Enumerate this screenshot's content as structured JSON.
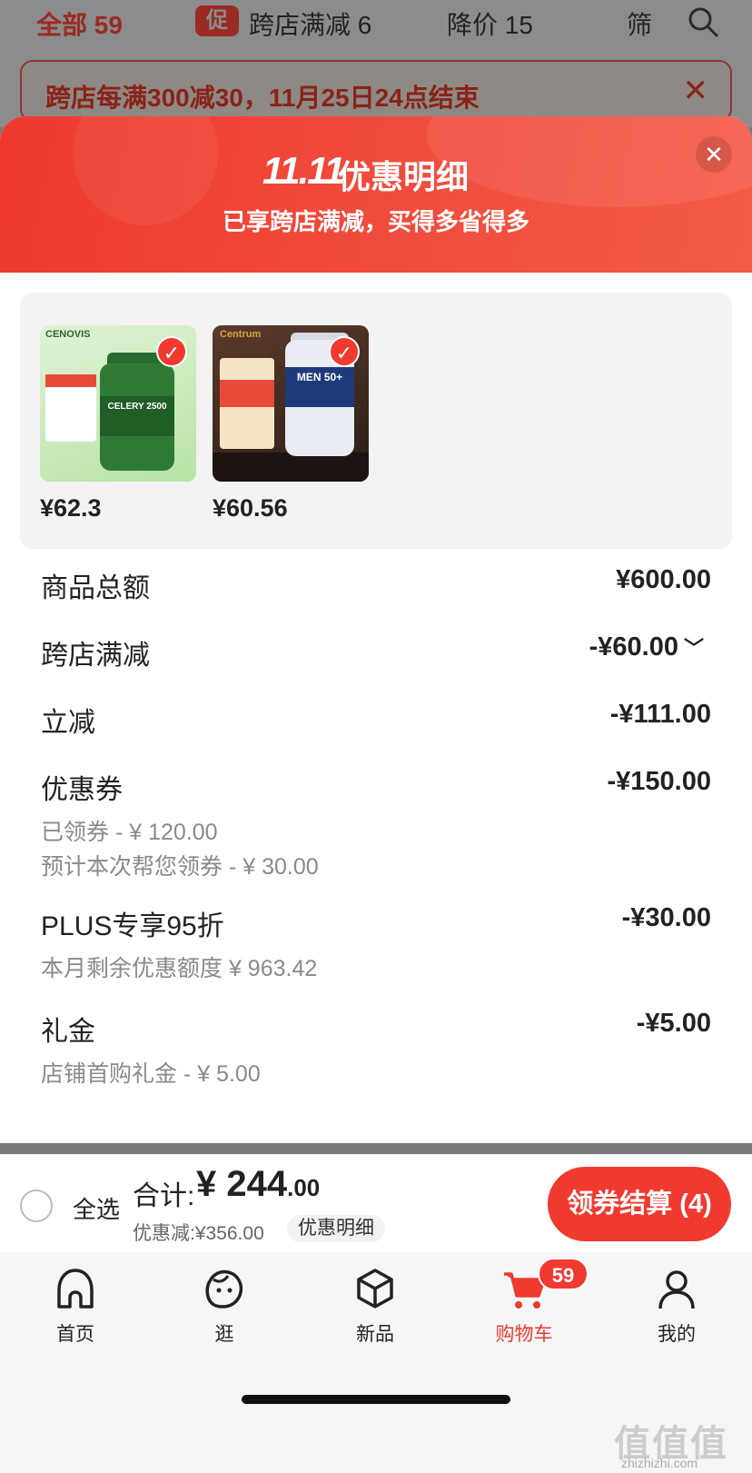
{
  "background": {
    "tabs": [
      {
        "label": "全部 59"
      },
      {
        "label": "跨店满减 6"
      },
      {
        "label": "降价 15"
      },
      {
        "label": "筛"
      }
    ],
    "promo_icon": "促",
    "notice": "跨店每满300减30，11月25日24点结束"
  },
  "sheet": {
    "logo": "11.11",
    "title": "优惠明细",
    "subtitle": "已享跨店满减，买得多省得多",
    "products": [
      {
        "price": "¥62.3",
        "brand": "CENOVIS",
        "label": "CELERY 2500",
        "image": "green-bottle"
      },
      {
        "price": "¥60.56",
        "brand": "Centrum",
        "label": "MEN 50+",
        "image": "white-bottle"
      }
    ],
    "rows": [
      {
        "label": "商品总额",
        "value": "¥600.00"
      },
      {
        "label": "跨店满减",
        "value": "-¥60.00"
      },
      {
        "label": "立减",
        "value": "-¥111.00"
      },
      {
        "label": "优惠券",
        "value": "-¥150.00",
        "subs": [
          "已领券 - ¥ 120.00",
          "预计本次帮您领券 - ¥ 30.00"
        ]
      },
      {
        "label": "PLUS专享95折",
        "value": "-¥30.00",
        "subs": [
          "本月剩余优惠额度 ¥ 963.42"
        ]
      },
      {
        "label": "礼金",
        "value": "-¥5.00",
        "subs": [
          "店铺首购礼金 - ¥ 5.00"
        ]
      }
    ]
  },
  "summary": {
    "select_all": "全选",
    "total_label": "合计:",
    "total_currency": "¥",
    "total_int": "244",
    "total_dec": ".00",
    "discount": "优惠减:¥356.00",
    "detail_link": "优惠明细",
    "checkout": "领券结算 (4)"
  },
  "tabbar": {
    "items": [
      {
        "label": "首页",
        "icon": "home-icon"
      },
      {
        "label": "逛",
        "icon": "face-icon"
      },
      {
        "label": "新品",
        "icon": "box-icon"
      },
      {
        "label": "购物车",
        "icon": "cart-icon",
        "badge": "59"
      },
      {
        "label": "我的",
        "icon": "person-icon"
      }
    ]
  },
  "watermark": {
    "text": "值值值",
    "url": "zhizhizhi.com"
  },
  "colors": {
    "accent": "#f03a30",
    "header": "#ef3a30"
  }
}
